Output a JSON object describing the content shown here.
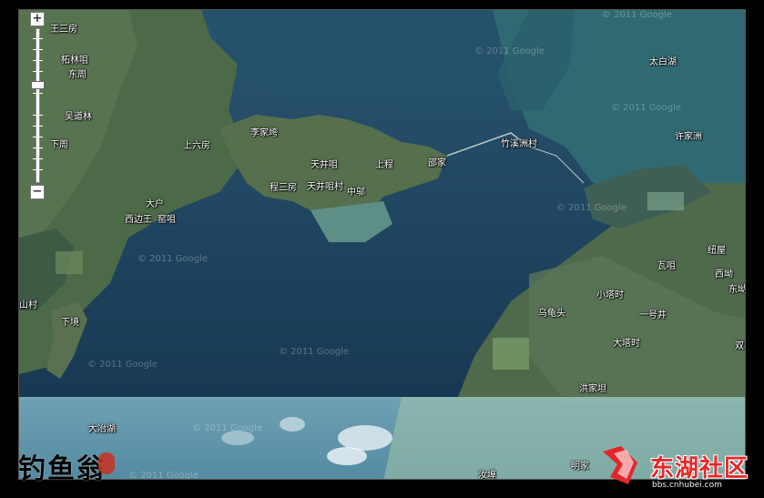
{
  "map": {
    "labels": [
      {
        "text": "王三房",
        "name": "label-wangsanfang"
      },
      {
        "text": "柘林咀",
        "name": "label-zhelinju"
      },
      {
        "text": "东周",
        "name": "label-dongzhou"
      },
      {
        "text": "吴道林",
        "name": "label-wudaolin"
      },
      {
        "text": "下周",
        "name": "label-xiazhou"
      },
      {
        "text": "上六房",
        "name": "label-shangliufang"
      },
      {
        "text": "李家垮",
        "name": "label-lijiakua"
      },
      {
        "text": "天井咀",
        "name": "label-tianjingju"
      },
      {
        "text": "程三房",
        "name": "label-chengsanfang"
      },
      {
        "text": "天井咀村",
        "name": "label-tianjingjucun"
      },
      {
        "text": "中邬",
        "name": "label-zhongwu"
      },
      {
        "text": "上程",
        "name": "label-shangcheng"
      },
      {
        "text": "邵家",
        "name": "label-shaojia"
      },
      {
        "text": "竹溪洲村",
        "name": "label-zhuxizhoucun"
      },
      {
        "text": "太白湖",
        "name": "label-taibaihu"
      },
      {
        "text": "许家洲",
        "name": "label-xujiazhou"
      },
      {
        "text": "大户",
        "name": "label-dahu"
      },
      {
        "text": "西边王",
        "name": "label-xibianwang"
      },
      {
        "text": "窑咀",
        "name": "label-yaoju"
      },
      {
        "text": "山村",
        "name": "label-shancun"
      },
      {
        "text": "下境",
        "name": "label-xiajing"
      },
      {
        "text": "纽屋",
        "name": "label-niuwu"
      },
      {
        "text": "瓦咀",
        "name": "label-waju"
      },
      {
        "text": "西坳",
        "name": "label-xiao"
      },
      {
        "text": "东坳",
        "name": "label-dongao"
      },
      {
        "text": "小塔时",
        "name": "label-xiaotashi"
      },
      {
        "text": "乌龟头",
        "name": "label-wuguitou"
      },
      {
        "text": "一号井",
        "name": "label-yihaojing"
      },
      {
        "text": "大塔时",
        "name": "label-datashi"
      },
      {
        "text": "双羊",
        "name": "label-shuangyang"
      },
      {
        "text": "洪家坦",
        "name": "label-hongjiatan"
      },
      {
        "text": "大冶湖",
        "name": "label-dayehu"
      },
      {
        "text": "明家",
        "name": "label-mingjia"
      },
      {
        "text": "汝埠",
        "name": "label-rubu"
      }
    ],
    "watermark": "© 2011 Google",
    "zoom_in": "+",
    "zoom_out": "−"
  },
  "signature": "钓鱼翁",
  "logo": {
    "text": "东湖社区",
    "url": "bbs.cnhubei.com"
  }
}
